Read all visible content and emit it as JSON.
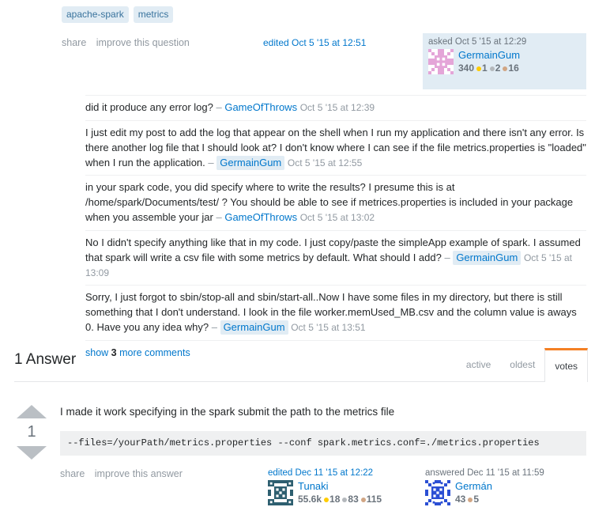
{
  "question": {
    "tags": [
      "apache-spark",
      "metrics"
    ],
    "post_menu": [
      "share",
      "improve this question"
    ],
    "edited_link": "edited Oct 5 '15 at 12:51",
    "asked_card": {
      "action_time": "asked Oct 5 '15 at 12:29",
      "user_name": "GermainGum",
      "reputation": "340",
      "gold": "1",
      "silver": "2",
      "bronze": "16",
      "avatar_name": "avatar-germaingum"
    }
  },
  "comments": [
    {
      "text": "did it produce any error log? ",
      "dash": "– ",
      "user": "GameOfThrows",
      "highlight": false,
      "time": "Oct 5 '15 at 12:39"
    },
    {
      "text": "I just edit my post to add the log that appear on the shell when I run my application and there isn't any error. Is there another log file that I should look at? I don't know where I can see if the file metrics.properties is \"loaded\" when I run the application. ",
      "dash": "– ",
      "user": "GermainGum",
      "highlight": true,
      "time": "Oct 5 '15 at 12:55"
    },
    {
      "text": "in your spark code, you did specify where to write the results? I presume this is at /home/spark/Documents/test/ ? You should be able to see if metrices.properties is included in your package when you assemble your jar ",
      "dash": "– ",
      "user": "GameOfThrows",
      "highlight": false,
      "time": "Oct 5 '15 at 13:02"
    },
    {
      "text": "No I didn't specify anything like that in my code. I just copy/paste the simpleApp example of spark. I assumed that spark will write a csv file with some metrics by default. What should I add? ",
      "dash": "– ",
      "user": "GermainGum",
      "highlight": true,
      "time": "Oct 5 '15 at 13:09"
    },
    {
      "text": "Sorry, I just forgot to sbin/stop-all and sbin/start-all..Now I have some files in my directory, but there is still something that I don't understand. I look in the file worker.memUsed_MB.csv and the column value is aways 0. Have you any idea why? ",
      "dash": "– ",
      "user": "GermainGum",
      "highlight": true,
      "time": "Oct 5 '15 at 13:51"
    }
  ],
  "show_more_comments": {
    "prefix": "show ",
    "count": "3",
    "suffix": " more comments"
  },
  "answers_header": {
    "title": "1 Answer",
    "tabs": [
      {
        "label": "active",
        "active": false
      },
      {
        "label": "oldest",
        "active": false
      },
      {
        "label": "votes",
        "active": true
      }
    ]
  },
  "answer": {
    "vote_count": "1",
    "body_text": "I made it work specifying in the spark submit the path to the metrics file",
    "code": "--files=/yourPath/metrics.properties --conf spark.metrics.conf=./metrics.properties",
    "post_menu": [
      "share",
      "improve this answer"
    ],
    "edited_card": {
      "action_label": "edited ",
      "action_time": "Dec 11 '15 at 12:22",
      "user_name": "Tunaki",
      "reputation": "55.6k",
      "gold": "18",
      "silver": "83",
      "bronze": "115",
      "avatar_name": "avatar-tunaki"
    },
    "answered_card": {
      "action_label": "answered ",
      "action_time": "Dec 11 '15 at 11:59",
      "user_name": "Germán",
      "reputation": "43",
      "bronze": "5",
      "avatar_name": "avatar-german"
    }
  },
  "colors": {
    "accent_orange": "#f48024",
    "link_blue": "#0077cc",
    "tag_bg": "#e1ecf4",
    "tag_text": "#39739d",
    "gold": "#ffcc01",
    "silver": "#b4b8bc",
    "bronze": "#d1a684",
    "code_bg": "#eff0f1"
  }
}
